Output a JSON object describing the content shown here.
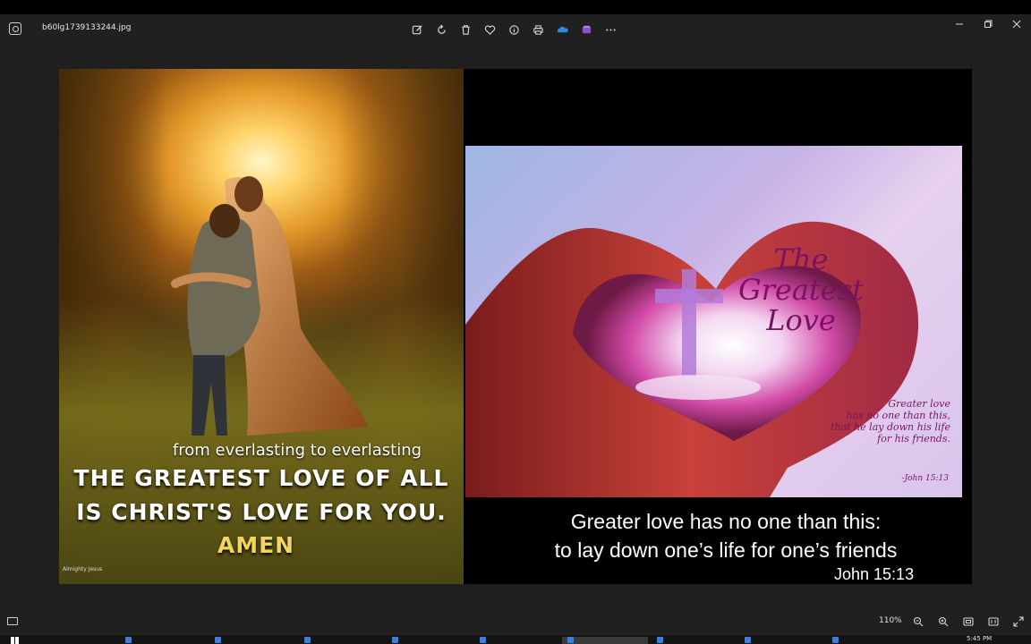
{
  "window": {
    "filename": "b60lg1739133244.jpg"
  },
  "toolbar": {
    "icons": [
      "edit-icon",
      "rotate-icon",
      "delete-icon",
      "favorite-icon",
      "info-icon",
      "print-icon",
      "onedrive-icon",
      "clipchamp-icon",
      "more-icon"
    ]
  },
  "left_image": {
    "subtitle": "from everlasting to everlasting",
    "headline_1": "THE GREATEST LOVE OF ALL",
    "headline_2": "IS CHRIST'S LOVE FOR YOU.",
    "amen": "AMEN",
    "watermark": "Almighty Jesus"
  },
  "right_image": {
    "title": "The Greatest Love",
    "verse_1": "Greater love",
    "verse_2": "has no one than this,",
    "verse_3": "that he lay down his life",
    "verse_4": "for his friends.",
    "reference": "-John 15:13"
  },
  "caption": {
    "line_1": "Greater love has no one than this:",
    "line_2": "to lay down one’s life for one’s friends",
    "reference": "John 15:13"
  },
  "statusbar": {
    "zoom": "110%"
  },
  "taskbar": {
    "clock": "5:45 PM"
  },
  "colors": {
    "accent_title": "#7a1264",
    "caption_amen": "#f4d55a",
    "background": "#1f1f1f"
  }
}
